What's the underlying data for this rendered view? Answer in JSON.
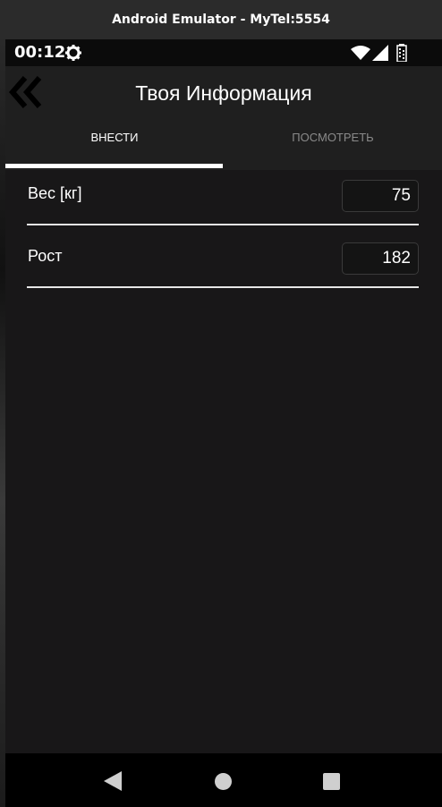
{
  "emulator": {
    "title": "Android Emulator - MyTel:5554"
  },
  "status_bar": {
    "time": "00:12",
    "icons": [
      "gear-icon",
      "wifi-icon",
      "signal-icon",
      "battery-icon"
    ]
  },
  "app_bar": {
    "title": "Твоя Информация",
    "back_icon": "double-chevron-left-icon"
  },
  "tabs": [
    {
      "label": "ВНЕСТИ",
      "selected": true
    },
    {
      "label": "ПОСМОТРЕТЬ",
      "selected": false
    }
  ],
  "form": {
    "weight": {
      "label": "Вес [кг]",
      "value": "75"
    },
    "height": {
      "label": "Рост",
      "value": "182"
    }
  },
  "nav_bar": {
    "icons": [
      "back-triangle-icon",
      "home-circle-icon",
      "recents-square-icon"
    ]
  },
  "colors": {
    "background": "#181718",
    "app_bar": "#1f1f1f",
    "text": "#ffffff",
    "inactive_tab": "#8a8a8a",
    "indicator": "#ffffff"
  }
}
